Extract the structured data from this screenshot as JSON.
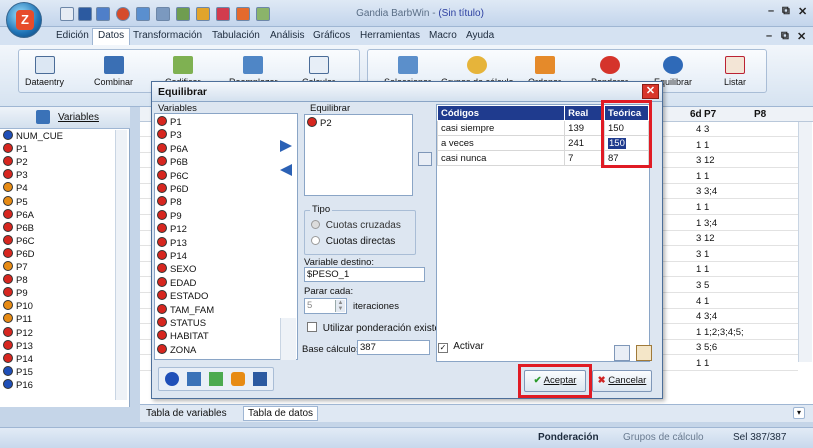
{
  "window": {
    "app_name": "Gandia BarbWin",
    "doc_name": "(Sin título)",
    "controls": [
      "–",
      "⧉",
      "✕"
    ],
    "ribbon_controls": [
      "–",
      "⧉",
      "✕"
    ]
  },
  "menu": [
    "Edición",
    "Datos",
    "Transformación",
    "Tabulación",
    "Análisis",
    "Gráficos",
    "Herramientas",
    "Macro",
    "Ayuda"
  ],
  "menu_active": "Datos",
  "ribbon": {
    "group1": [
      "Dataentry",
      "Combinar",
      "Codificar",
      "Reemplazar",
      "Calcular"
    ],
    "group2": [
      "Seleccionar",
      "Grupos de cálculo",
      "Ordenar",
      "Ponderar",
      "Equilibrar",
      "Listar"
    ]
  },
  "variables_panel": {
    "title": "Variables",
    "items": [
      {
        "name": "NUM_CUE",
        "type": "n"
      },
      {
        "name": "P1",
        "type": "r"
      },
      {
        "name": "P2",
        "type": "r"
      },
      {
        "name": "P3",
        "type": "r"
      },
      {
        "name": "P4",
        "type": "m"
      },
      {
        "name": "P5",
        "type": "m"
      },
      {
        "name": "P6A",
        "type": "r"
      },
      {
        "name": "P6B",
        "type": "r"
      },
      {
        "name": "P6C",
        "type": "r"
      },
      {
        "name": "P6D",
        "type": "r"
      },
      {
        "name": "P7",
        "type": "m"
      },
      {
        "name": "P8",
        "type": "r"
      },
      {
        "name": "P9",
        "type": "r"
      },
      {
        "name": "P10",
        "type": "m"
      },
      {
        "name": "P11",
        "type": "m"
      },
      {
        "name": "P12",
        "type": "r"
      },
      {
        "name": "P13",
        "type": "r"
      },
      {
        "name": "P14",
        "type": "r"
      },
      {
        "name": "P15",
        "type": "n"
      },
      {
        "name": "P16",
        "type": "n"
      }
    ]
  },
  "grid": {
    "headers": [
      "6d",
      "P7",
      "P8"
    ],
    "rows": [
      [
        "4",
        "3",
        ""
      ],
      [
        "1",
        "1",
        ""
      ],
      [
        "3",
        "12",
        ""
      ],
      [
        "1",
        "1",
        ""
      ],
      [
        "3",
        "3;4",
        ""
      ],
      [
        "1",
        "1",
        ""
      ],
      [
        "1",
        "3;4",
        ""
      ],
      [
        "3",
        "12",
        ""
      ],
      [
        "3",
        "1",
        ""
      ],
      [
        "1",
        "1",
        ""
      ],
      [
        "3",
        "5",
        ""
      ],
      [
        "4",
        "1",
        ""
      ],
      [
        "4",
        "3;4",
        ""
      ],
      [
        "1",
        "1;2;3;4;5;",
        ""
      ],
      [
        "3",
        "5;6",
        ""
      ],
      [
        "1",
        "1",
        ""
      ]
    ]
  },
  "dialog": {
    "title": "Equilibrar",
    "variables_label": "Variables",
    "variables": [
      "P1",
      "P3",
      "P6A",
      "P6B",
      "P6C",
      "P6D",
      "P8",
      "P9",
      "P12",
      "P13",
      "P14",
      "SEXO",
      "EDAD",
      "ESTADO",
      "TAM_FAM",
      "STATUS",
      "HABITAT",
      "ZONA"
    ],
    "equilibrar_label": "Equilibrar",
    "equilibrar_items": [
      "P2"
    ],
    "tipo_label": "Tipo",
    "tipo_options": [
      "Cuotas cruzadas",
      "Cuotas directas"
    ],
    "destino_label": "Variable destino:",
    "destino_value": "$PESO_1",
    "parar_label": "Parar cada:",
    "parar_value": "5",
    "iteraciones_label": "iteraciones",
    "utilizar_label": "Utilizar ponderación existente",
    "base_label": "Base cálculo:",
    "base_value": "387",
    "activar_label": "Activar",
    "table": {
      "headers": [
        "Códigos",
        "Real",
        "Teórica"
      ],
      "rows": [
        [
          "casi siempre",
          "139",
          "150"
        ],
        [
          "a veces",
          "241",
          "150"
        ],
        [
          "casi nunca",
          "7",
          "87"
        ]
      ]
    },
    "accept_label": "Aceptar",
    "cancel_label": "Cancelar"
  },
  "bottom_tabs": [
    "Tabla de variables",
    "Tabla de datos"
  ],
  "status": {
    "ponderacion": "Ponderación",
    "grupos": "Grupos de cálculo",
    "sel": "Sel 387/387"
  }
}
